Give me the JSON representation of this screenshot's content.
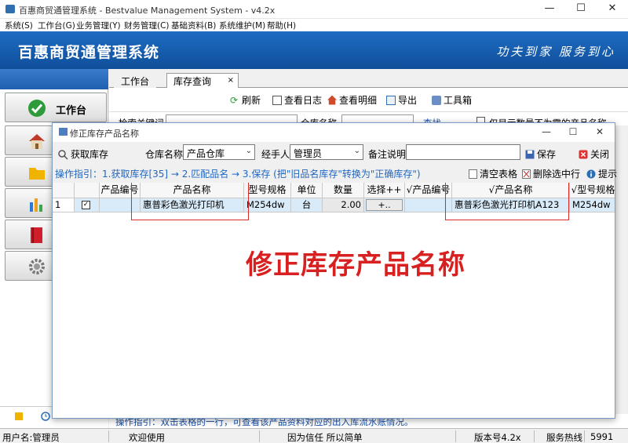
{
  "window": {
    "title": "百惠商贸通管理系统 - Bestvalue Management System - v4.2x",
    "controls": [
      "—",
      "☐",
      "✕"
    ]
  },
  "menu": [
    "系统(S)",
    "工作台(G)",
    "业务管理(Y)",
    "财务管理(C)",
    "基础资料(B)",
    "系统维护(M)",
    "帮助(H)"
  ],
  "banner": {
    "title": "百惠商贸通管理系统",
    "slogan": "功夫到家 服务到心"
  },
  "sidebar": {
    "items": [
      {
        "label": "工作台",
        "icon": "checkmark-icon",
        "color": "#2e9b3b"
      },
      {
        "label": "",
        "icon": "home-icon",
        "color": "#c0392b"
      },
      {
        "label": "",
        "icon": "folder-icon",
        "color": "#f0b400"
      },
      {
        "label": "",
        "icon": "chart-icon",
        "color": "#2b7bd3"
      },
      {
        "label": "",
        "icon": "book-icon",
        "color": "#d01f2b"
      },
      {
        "label": "",
        "icon": "gear-icon",
        "color": "#777777"
      }
    ]
  },
  "tabs": [
    {
      "label": "工作台",
      "active": false
    },
    {
      "label": "库存查询",
      "active": true,
      "close": "×"
    }
  ],
  "main_toolbar": [
    "刷新",
    "查看日志",
    "查看明细",
    "导出",
    "工具箱"
  ],
  "main_search": {
    "keyword_label": "检索关键词",
    "warehouse_label": "仓库名称",
    "query_button": "查找",
    "only_checkbox": "仅显示数量不为零的产品名称"
  },
  "main_hint": "操作指引：双击表格的一行，可查看该产品资料对应的出入库流水账情况。",
  "dialog": {
    "title": "修正库存产品名称",
    "controls": [
      "—",
      "☐",
      "✕"
    ],
    "get_stock_button": "获取库存",
    "warehouse_label": "仓库名称",
    "warehouse_value": "产品仓库",
    "handler_label": "经手人",
    "handler_value": "管理员",
    "note_label": "备注说明",
    "note_value": "",
    "save_button": "保存",
    "close_button": "关闭",
    "hint": "操作指引：1.获取库存[35] → 2.匹配品名 → 3.保存 (把\"旧品名库存\"转换为\"正确库存\")",
    "clear_button": "清空表格",
    "delete_row_button": "删除选中行",
    "tip_button": "提示",
    "columns": [
      "",
      "",
      "产品编号",
      "产品名称",
      "型号规格",
      "单位",
      "数量",
      "选择++",
      "√产品编号",
      "√产品名称",
      "√型号规格"
    ],
    "rows": [
      {
        "row_no": "1",
        "checked": true,
        "code": "",
        "name": "惠普彩色激光打印机",
        "model": "M254dw",
        "unit": "台",
        "qty": "2.00",
        "select": "+..",
        "new_code": "",
        "new_name": "惠普彩色激光打印机A123",
        "new_model": "M254dw"
      }
    ]
  },
  "annotation": "修正库存产品名称",
  "statusbar": {
    "user": "用户名:管理员",
    "welcome": "欢迎使用",
    "motto": "因为信任 所以简单",
    "version": "版本号4.2x",
    "service": "服务热线",
    "phone": "5991"
  }
}
